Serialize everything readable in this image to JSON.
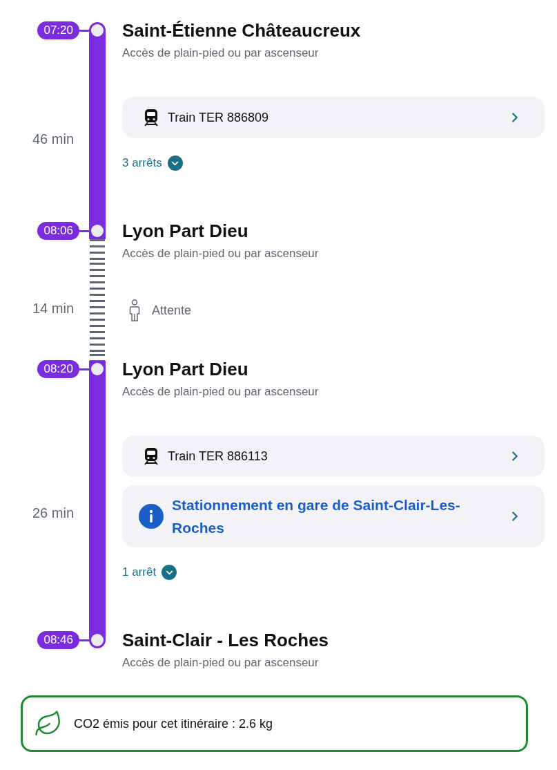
{
  "journey": [
    {
      "kind": "stop",
      "time": "07:20",
      "name": "Saint-Étienne Châteaucreux",
      "note": "Accès de plain-pied ou par ascenseur"
    },
    {
      "kind": "train",
      "duration": "46 min",
      "cards": [
        {
          "kind": "vehicle",
          "label": "Train TER 886809"
        }
      ],
      "stops_toggle": {
        "label": "3 arrêts",
        "expanded": false
      }
    },
    {
      "kind": "stop",
      "time": "08:06",
      "name": "Lyon Part Dieu",
      "note": "Accès de plain-pied ou par ascenseur"
    },
    {
      "kind": "wait",
      "duration": "14 min",
      "label": "Attente"
    },
    {
      "kind": "stop",
      "time": "08:20",
      "name": "Lyon Part Dieu",
      "note": "Accès de plain-pied ou par ascenseur"
    },
    {
      "kind": "train",
      "duration": "26 min",
      "cards": [
        {
          "kind": "vehicle",
          "label": "Train TER 886113"
        },
        {
          "kind": "info",
          "label": "Stationnement en gare de Saint-Clair-Les-Roches"
        }
      ],
      "stops_toggle": {
        "label": "1 arrêt",
        "expanded": false
      }
    },
    {
      "kind": "stop",
      "time": "08:46",
      "name": "Saint-Clair - Les Roches",
      "note": "Accès de plain-pied ou par ascenseur"
    }
  ],
  "co2": {
    "text": "CO2 émis pour cet itinéraire : 2.6 kg"
  }
}
